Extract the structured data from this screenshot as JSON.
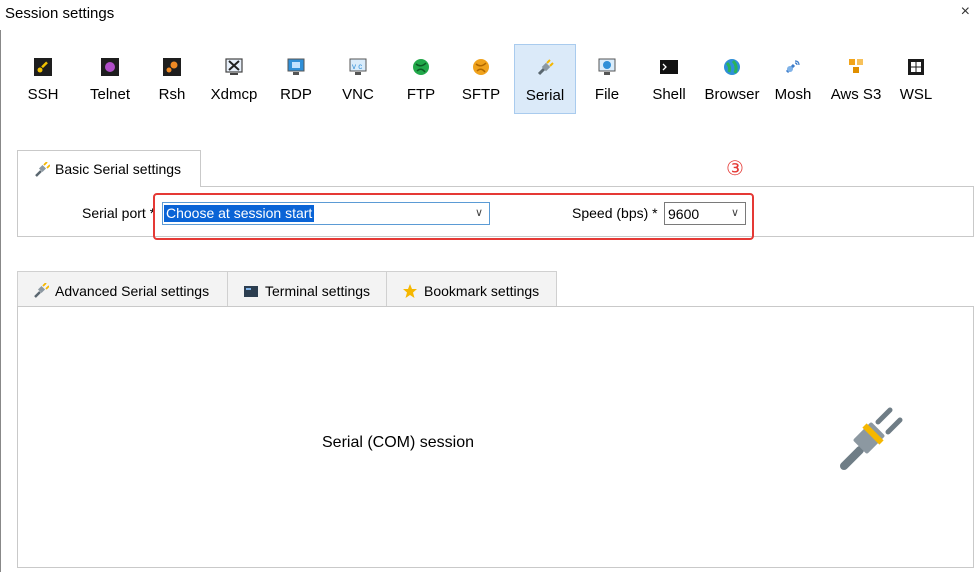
{
  "window": {
    "title": "Session settings",
    "close": "×"
  },
  "toolbar": {
    "items": [
      {
        "label": "SSH",
        "icon": "key-icon",
        "color": "#1e1e1e",
        "accent": "#f2c200"
      },
      {
        "label": "Telnet",
        "icon": "telnet-icon",
        "color": "#1e1e1e",
        "accent": "#b04ec8"
      },
      {
        "label": "Rsh",
        "icon": "rsh-icon",
        "color": "#1e1e1e",
        "accent": "#f08a24"
      },
      {
        "label": "Xdmcp",
        "icon": "x-icon",
        "color": "#2b2b2b",
        "accent": "#3c7bd0"
      },
      {
        "label": "RDP",
        "icon": "rdp-monitor-icon",
        "color": "#2f8fd8",
        "accent": "#2f8fd8"
      },
      {
        "label": "VNC",
        "icon": "vnc-monitor-icon",
        "color": "#2f8fd8",
        "accent": "#2f8fd8"
      },
      {
        "label": "FTP",
        "icon": "ftp-globe-icon",
        "color": "#22a84a",
        "accent": "#22a84a"
      },
      {
        "label": "SFTP",
        "icon": "sftp-globe-icon",
        "color": "#f0a21c",
        "accent": "#f0a21c"
      },
      {
        "label": "Serial",
        "icon": "serial-plug-icon",
        "color": "#5a6770",
        "accent": "#f5b700"
      },
      {
        "label": "File",
        "icon": "file-monitor-icon",
        "color": "#2f8fd8",
        "accent": "#2f8fd8"
      },
      {
        "label": "Shell",
        "icon": "shell-terminal-icon",
        "color": "#111111",
        "accent": "#ffffff"
      },
      {
        "label": "Browser",
        "icon": "browser-globe-icon",
        "color": "#2a9d8f",
        "accent": "#2f8fd8"
      },
      {
        "label": "Mosh",
        "icon": "mosh-satellite-icon",
        "color": "#3d7cc9",
        "accent": "#3d7cc9"
      },
      {
        "label": "Aws S3",
        "icon": "aws-cubes-icon",
        "color": "#f2a41a",
        "accent": "#f2a41a"
      },
      {
        "label": "WSL",
        "icon": "windows-icon",
        "color": "#1a1a1a",
        "accent": "#ffffff"
      }
    ],
    "active": "Serial"
  },
  "basic_tab": {
    "label": "Basic Serial settings"
  },
  "serial_port": {
    "label": "Serial port *",
    "value": "Choose at session start"
  },
  "speed": {
    "label": "Speed (bps) *",
    "value": "9600"
  },
  "annotation": {
    "number": "③",
    "color": "#e53935"
  },
  "lower_tabs": [
    {
      "label": "Advanced Serial settings",
      "icon": "plug-icon"
    },
    {
      "label": "Terminal settings",
      "icon": "terminal-icon"
    },
    {
      "label": "Bookmark settings",
      "icon": "star-icon"
    }
  ],
  "main": {
    "session_text": "Serial (COM) session"
  }
}
